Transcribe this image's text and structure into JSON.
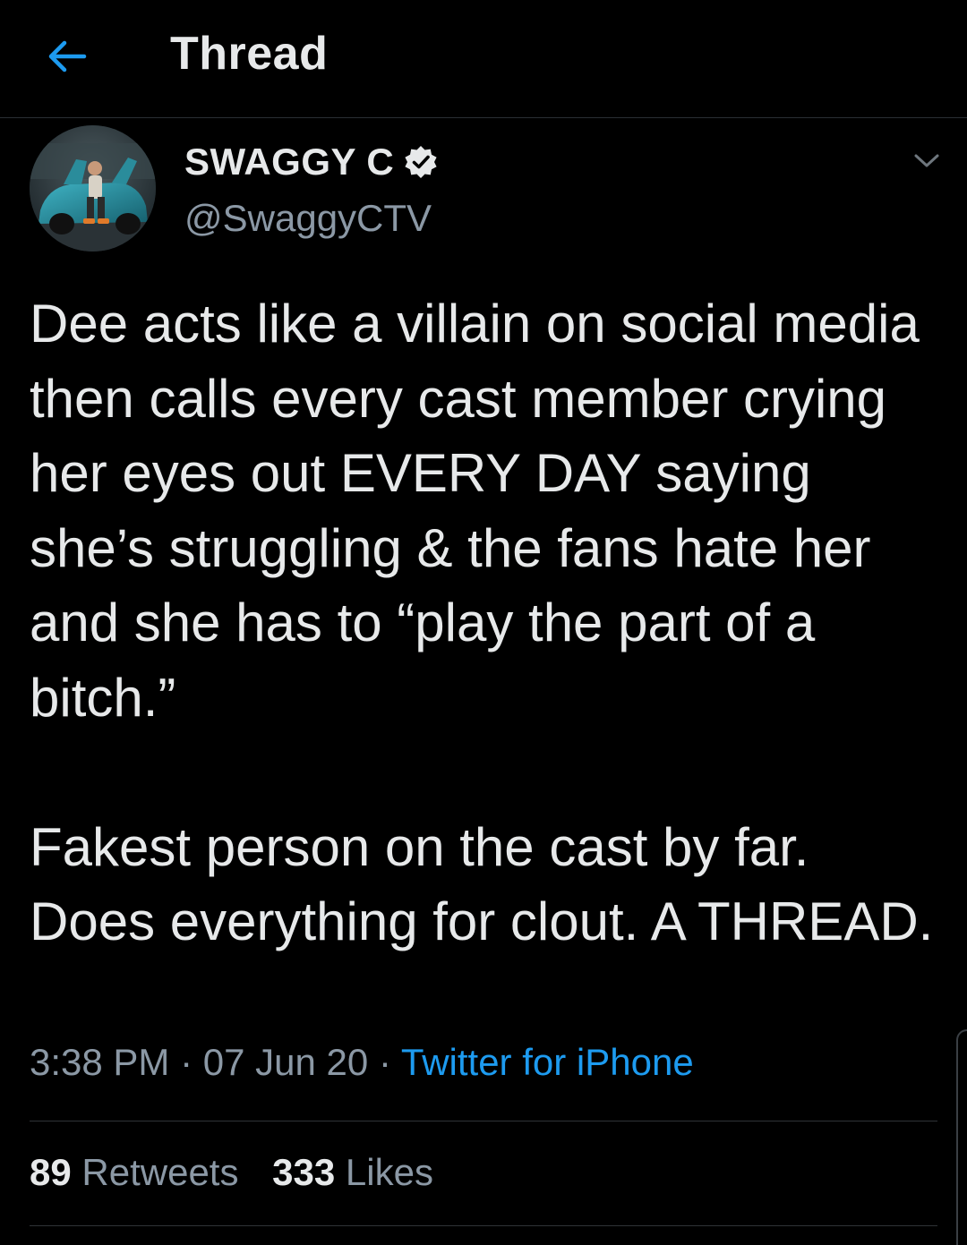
{
  "header": {
    "title": "Thread",
    "back_icon": "arrow-left-icon",
    "accent_color": "#1d9bf0"
  },
  "tweet": {
    "author": {
      "display_name": "SWAGGY C",
      "handle": "@SwaggyCTV",
      "verified": true,
      "verified_icon": "verified-badge-icon"
    },
    "menu_icon": "chevron-down-icon",
    "paragraphs": [
      "Dee acts like a villain on social media then calls every cast member crying her eyes out EVERY DAY saying she’s struggling & the fans hate her and she has to “play the part of a bitch.”",
      "Fakest person on the cast by far. Does everything for clout. A THREAD."
    ],
    "time": "3:38 PM",
    "date": "07 Jun 20",
    "separator": "·",
    "source": "Twitter for iPhone",
    "retweets_count": "89",
    "retweets_label": "Retweets",
    "likes_count": "333",
    "likes_label": "Likes"
  },
  "colors": {
    "background": "#000000",
    "text_primary": "#e7e9ea",
    "text_secondary": "#8b98a5",
    "link": "#1d9bf0",
    "divider": "#2f3336"
  }
}
